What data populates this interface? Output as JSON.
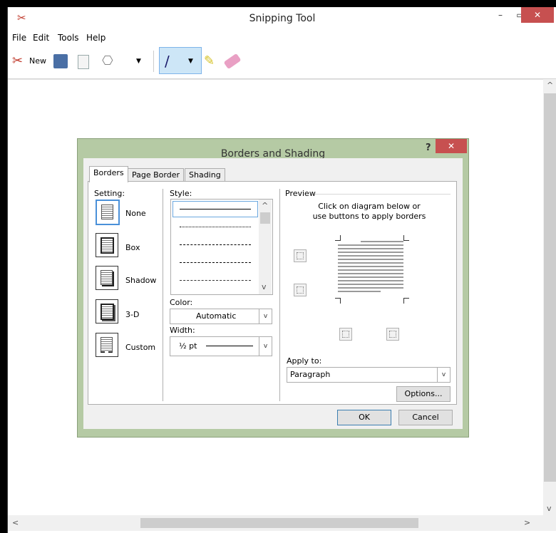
{
  "window": {
    "title": "Snipping Tool",
    "minimize": "–",
    "maximize": "▭",
    "close": "✕"
  },
  "menu": {
    "file": "File",
    "edit": "Edit",
    "tools": "Tools",
    "help": "Help"
  },
  "toolbar": {
    "new_label": "New"
  },
  "dialog": {
    "title": "Borders and Shading",
    "help": "?",
    "close": "✕",
    "tabs": [
      "Borders",
      "Page Border",
      "Shading"
    ],
    "setting_label": "Setting:",
    "settings": [
      "None",
      "Box",
      "Shadow",
      "3-D",
      "Custom"
    ],
    "style_label": "Style:",
    "color_label": "Color:",
    "color_value": "Automatic",
    "width_label": "Width:",
    "width_value": "½ pt",
    "preview_label": "Preview",
    "preview_hint_1": "Click on diagram below or",
    "preview_hint_2": "use buttons to apply borders",
    "apply_label": "Apply to:",
    "apply_value": "Paragraph",
    "options_button": "Options...",
    "ok_button": "OK",
    "cancel_button": "Cancel"
  },
  "colors": {
    "dialog_frame": "#b5caa4",
    "close_red": "#c75050",
    "selection_blue": "#cde6f7"
  }
}
